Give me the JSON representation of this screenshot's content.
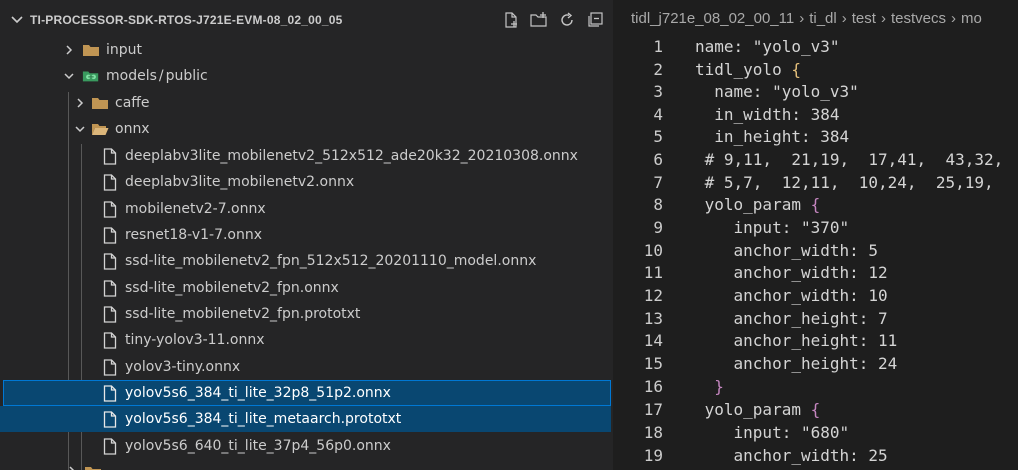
{
  "explorer": {
    "title": "TI-PROCESSOR-SDK-RTOS-J721E-EVM-08_02_00_05",
    "actions": [
      "new-file",
      "new-folder",
      "refresh",
      "collapse-all"
    ],
    "items": [
      {
        "label": "input",
        "kind": "folder",
        "expanded": false
      },
      {
        "label": "models",
        "sep": "/",
        "label2": "public",
        "kind": "folder-special",
        "expanded": true
      },
      {
        "label": "caffe",
        "kind": "folder",
        "expanded": false
      },
      {
        "label": "onnx",
        "kind": "folder",
        "expanded": true
      },
      {
        "label": "deeplabv3lite_mobilenetv2_512x512_ade20k32_20210308.onnx",
        "kind": "file"
      },
      {
        "label": "deeplabv3lite_mobilenetv2.onnx",
        "kind": "file"
      },
      {
        "label": "mobilenetv2-7.onnx",
        "kind": "file"
      },
      {
        "label": "resnet18-v1-7.onnx",
        "kind": "file"
      },
      {
        "label": "ssd-lite_mobilenetv2_fpn_512x512_20201110_model.onnx",
        "kind": "file"
      },
      {
        "label": "ssd-lite_mobilenetv2_fpn.onnx",
        "kind": "file"
      },
      {
        "label": "ssd-lite_mobilenetv2_fpn.prototxt",
        "kind": "file"
      },
      {
        "label": "tiny-yolov3-11.onnx",
        "kind": "file"
      },
      {
        "label": "yolov3-tiny.onnx",
        "kind": "file"
      },
      {
        "label": "yolov5s6_384_ti_lite_32p8_51p2.onnx",
        "kind": "file",
        "state": "focused"
      },
      {
        "label": "yolov5s6_384_ti_lite_metaarch.prototxt",
        "kind": "file",
        "state": "selected"
      },
      {
        "label": "yolov5s6_640_ti_lite_37p4_56p0.onnx",
        "kind": "file"
      }
    ]
  },
  "editor": {
    "breadcrumb": [
      "tidl_j721e_08_02_00_11",
      "ti_dl",
      "test",
      "testvecs",
      "mo"
    ],
    "lines": [
      {
        "n": "1",
        "text": "name: \"yolo_v3\""
      },
      {
        "n": "2",
        "text": "tidl_yolo ",
        "open": "{"
      },
      {
        "n": "3",
        "text": "  name: \"yolo_v3\""
      },
      {
        "n": "4",
        "text": "  in_width: 384"
      },
      {
        "n": "5",
        "text": "  in_height: 384"
      },
      {
        "n": "6",
        "text": " # 9,11,  21,19,  17,41,  43,32,"
      },
      {
        "n": "7",
        "text": " # 5,7,  12,11,  10,24,  25,19,"
      },
      {
        "n": "8",
        "text": " yolo_param ",
        "open": "{"
      },
      {
        "n": "9",
        "text": "    input: \"370\""
      },
      {
        "n": "10",
        "text": "    anchor_width: 5"
      },
      {
        "n": "11",
        "text": "    anchor_width: 12"
      },
      {
        "n": "12",
        "text": "    anchor_width: 10"
      },
      {
        "n": "13",
        "text": "    anchor_height: 7"
      },
      {
        "n": "14",
        "text": "    anchor_height: 11"
      },
      {
        "n": "15",
        "text": "    anchor_height: 24"
      },
      {
        "n": "16",
        "text": "  ",
        "close": "}"
      },
      {
        "n": "17",
        "text": " yolo_param ",
        "open": "{"
      },
      {
        "n": "18",
        "text": "    input: \"680\""
      },
      {
        "n": "19",
        "text": "    anchor_width: 25"
      }
    ]
  }
}
